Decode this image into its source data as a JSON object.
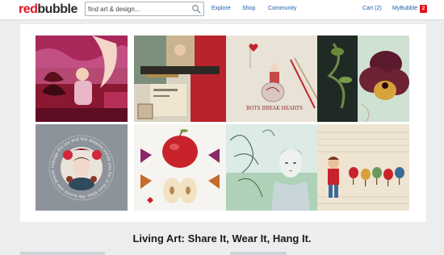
{
  "header": {
    "logo_part1": "red",
    "logo_part2": "bubble",
    "search_placeholder": "find art & design...",
    "nav": [
      {
        "label": "Explore"
      },
      {
        "label": "Shop"
      },
      {
        "label": "Community"
      }
    ],
    "cart_label": "Cart (2)",
    "mybubble_label": "MyBubble",
    "notification_count": "2"
  },
  "gallery": {
    "tiles": [
      {
        "name": "artwork-moon-girl"
      },
      {
        "name": "artwork-helicopter-collage"
      },
      {
        "name": "artwork-bots-break-hearts",
        "caption": "BOTS BREAK HEARTS"
      },
      {
        "name": "artwork-pansy-flower"
      },
      {
        "name": "artwork-circle-portrait",
        "circle_text": "indulge the joy and the dreams inside you for in their bliss, life bursts into bloom"
      },
      {
        "name": "artwork-apple-butterflies"
      },
      {
        "name": "artwork-watercolor-face"
      },
      {
        "name": "artwork-boy-with-birds"
      }
    ]
  },
  "headline": "Living Art: Share It, Wear It, Hang It.",
  "colors": {
    "brand_red": "#e41321",
    "link_blue": "#1d5ea8",
    "page_bg": "#ebedef"
  }
}
